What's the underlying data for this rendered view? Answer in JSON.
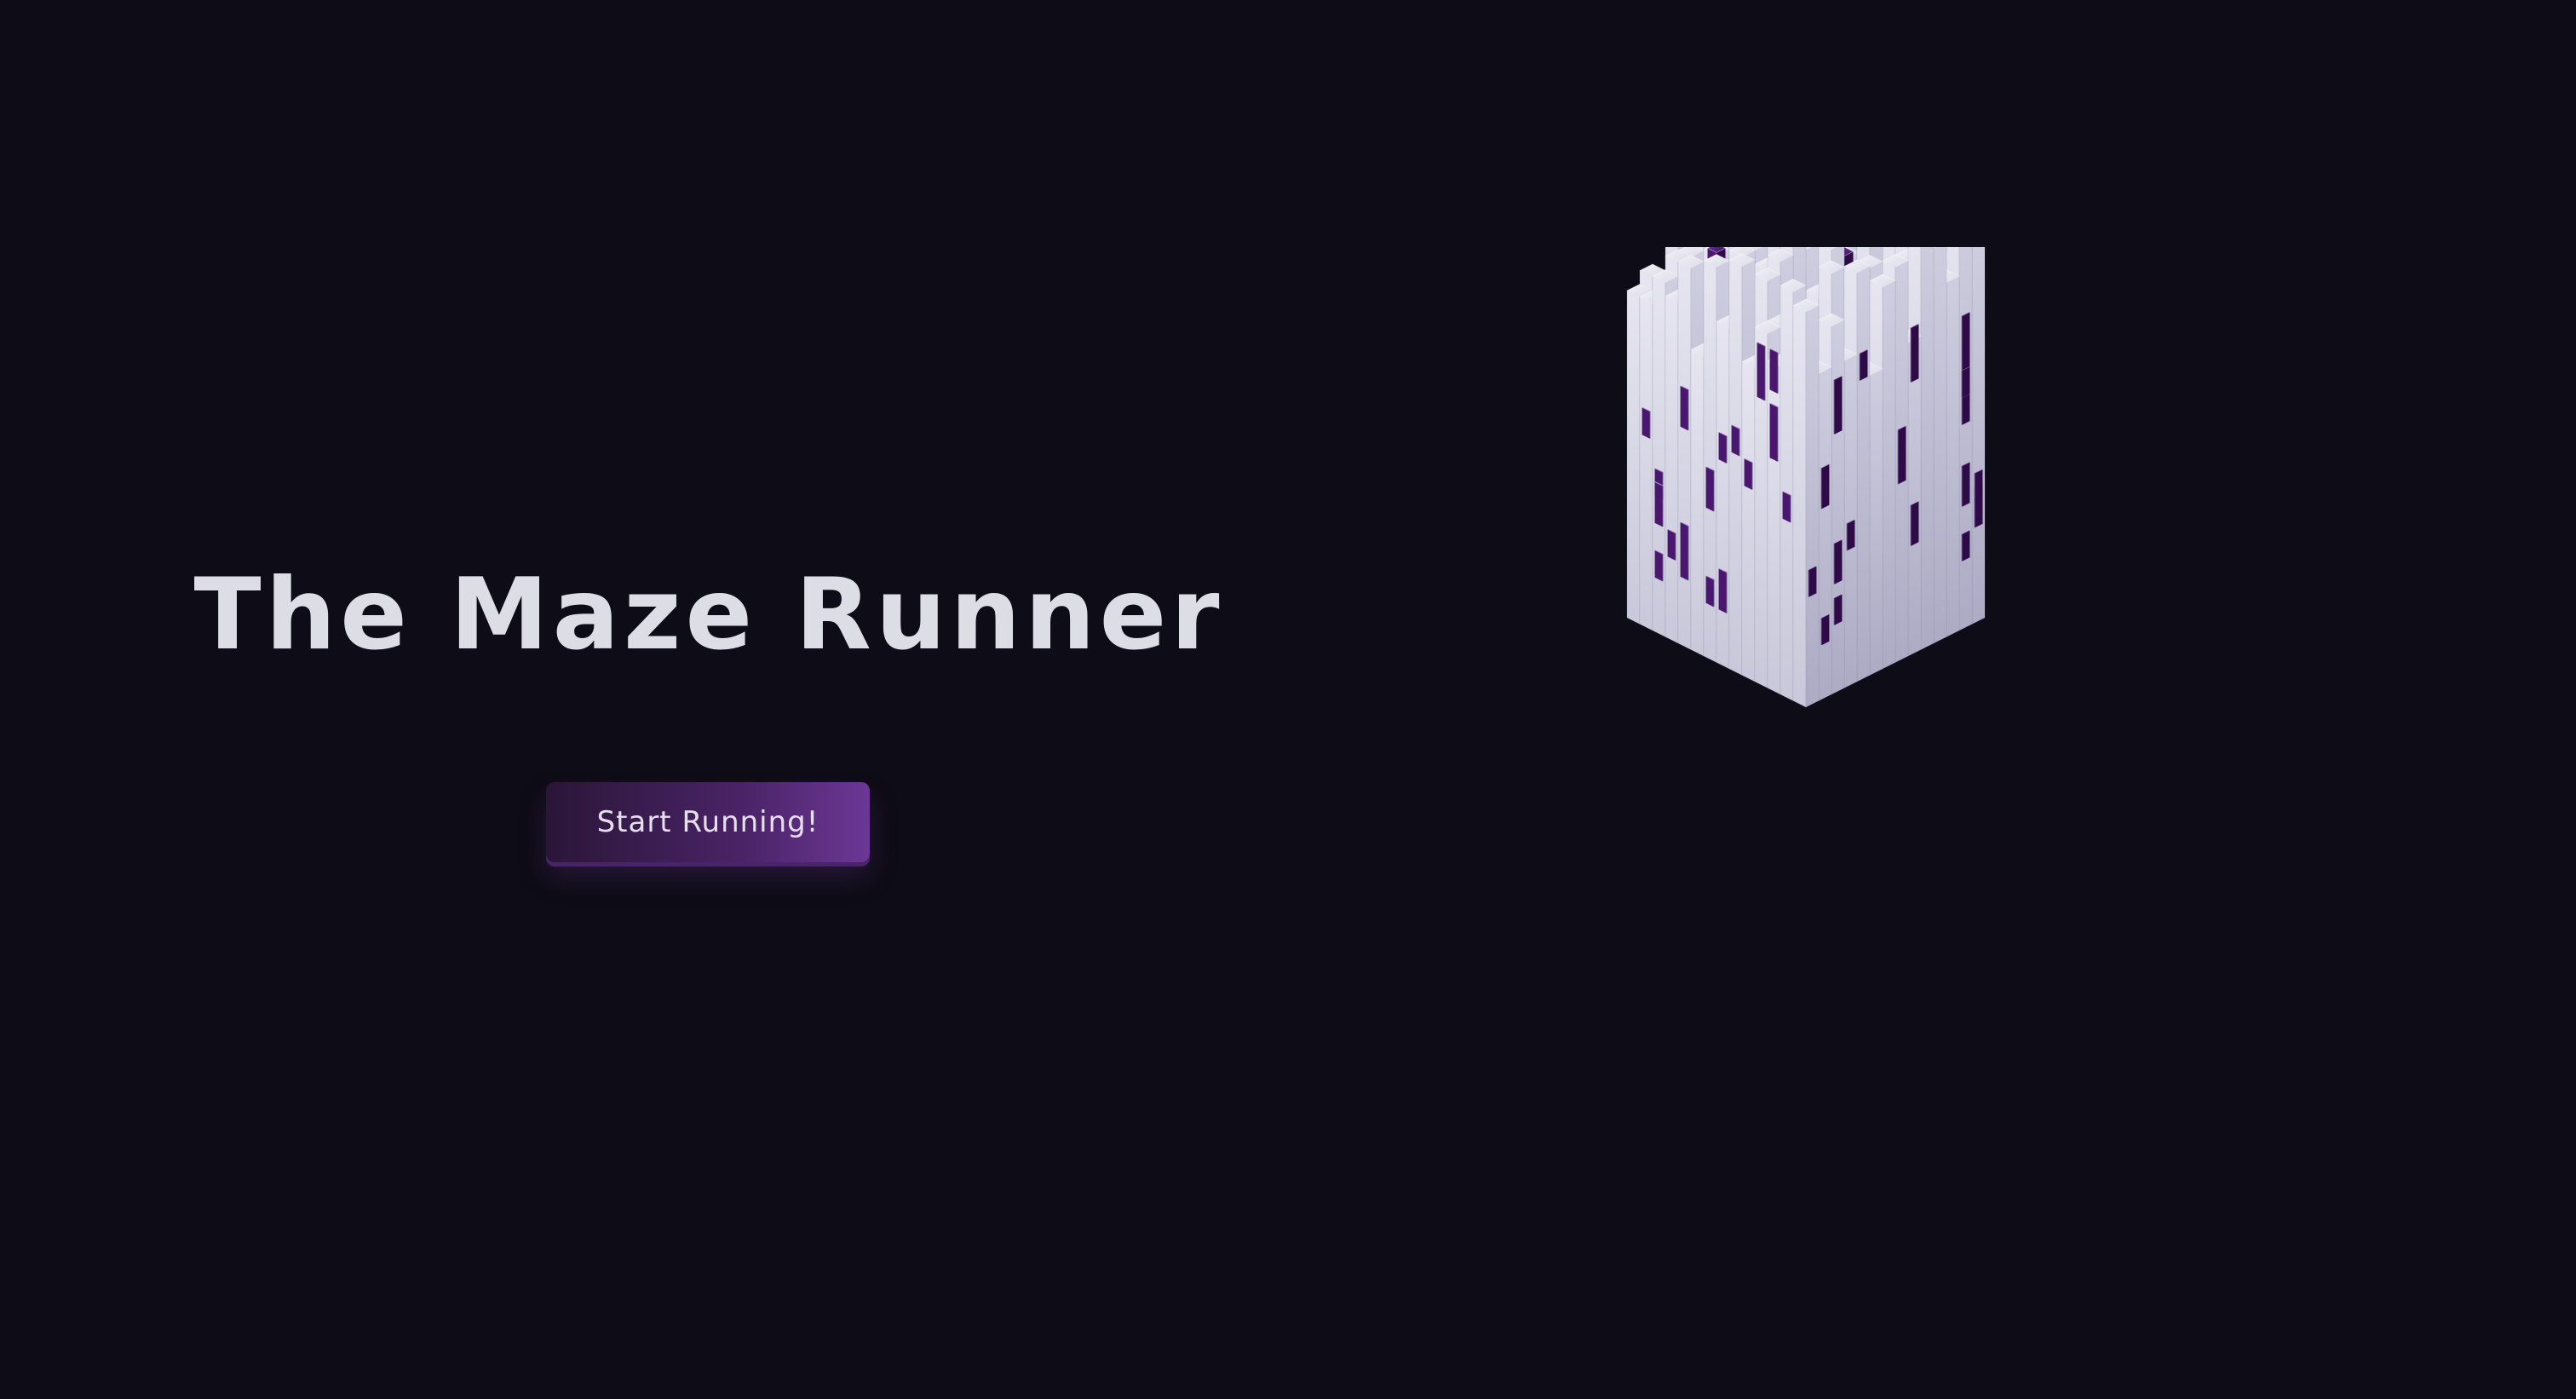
{
  "hero": {
    "title": "The Maze Runner",
    "start_button_label": "Start Running!"
  },
  "art": {
    "icon": "isometric-voxel-maze-cube-icon"
  },
  "colors": {
    "background": "#0e0c16",
    "title_text": "#dddde6",
    "button_gradient_start": "#2a1638",
    "button_gradient_end": "#6c3796",
    "block_light": "#e4e3ef",
    "block_shade": "#b4b2c8",
    "accent_purple": "#5a1d86"
  }
}
